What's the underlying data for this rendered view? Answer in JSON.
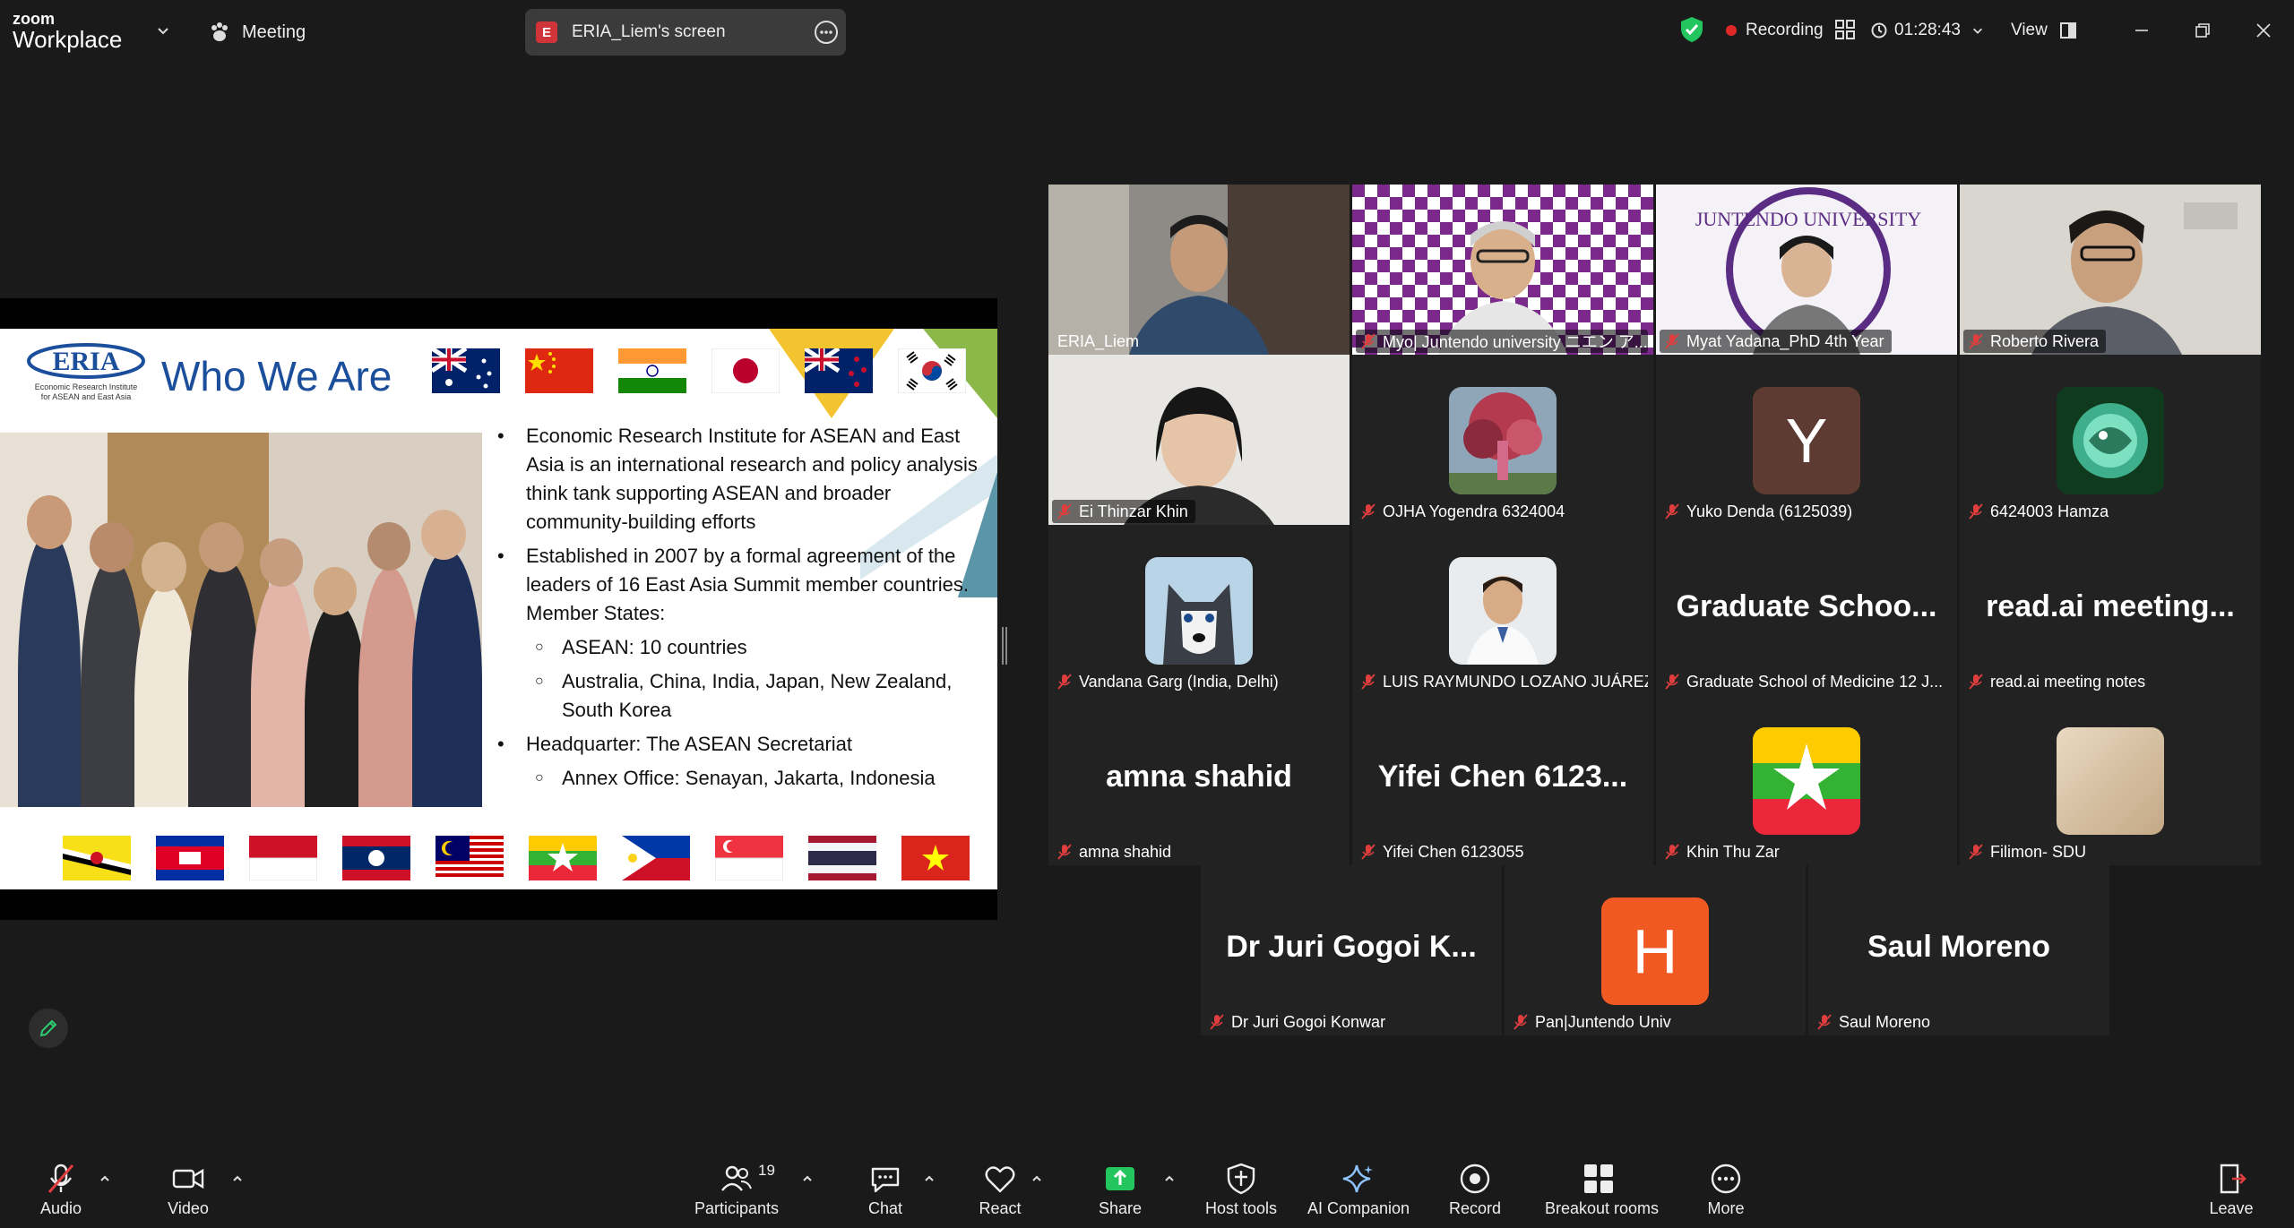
{
  "app": {
    "logo_top": "zoom",
    "logo_bottom": "Workplace",
    "meeting_label": "Meeting",
    "screen_badge": "E",
    "screen_label": "ERIA_Liem's screen",
    "recording_label": "Recording",
    "timer": "01:28:43",
    "view_label": "View"
  },
  "slide": {
    "title": "Who We Are",
    "bullets": [
      {
        "level": 1,
        "text": "Economic Research Institute for ASEAN and East Asia is an international research and policy analysis think tank supporting ASEAN and broader community-building efforts"
      },
      {
        "level": 1,
        "text": "Established in 2007 by a formal agreement of the leaders of 16 East Asia Summit member countries. Member States:"
      },
      {
        "level": 2,
        "text": "ASEAN: 10 countries"
      },
      {
        "level": 2,
        "text": "Australia, China, India, Japan, New Zealand, South Korea"
      },
      {
        "level": 1,
        "text": "Headquarter: The ASEAN Secretariat"
      },
      {
        "level": 2,
        "text": "Annex Office: Senayan, Jakarta, Indonesia"
      }
    ]
  },
  "participants": [
    {
      "name": "ERIA_Liem",
      "big": "",
      "kind": "camera",
      "active": true,
      "muted": false
    },
    {
      "name": "Myo| Juntendo university ニエン ア...",
      "big": "",
      "kind": "camera",
      "active": false,
      "muted": true
    },
    {
      "name": "Myat Yadana_PhD 4th Year",
      "big": "",
      "kind": "camera",
      "active": false,
      "muted": true
    },
    {
      "name": "Roberto Rivera",
      "big": "",
      "kind": "camera",
      "active": false,
      "muted": true
    },
    {
      "name": "Ei Thinzar Khin",
      "big": "",
      "kind": "camera",
      "active": false,
      "muted": true
    },
    {
      "name": "OJHA Yogendra 6324004",
      "big": "",
      "kind": "avatar",
      "active": false,
      "muted": true
    },
    {
      "name": "Yuko Denda (6125039)",
      "big": "Y",
      "kind": "letter",
      "active": false,
      "muted": true
    },
    {
      "name": "6424003 Hamza",
      "big": "",
      "kind": "avatar",
      "active": false,
      "muted": true
    },
    {
      "name": "Vandana Garg (India, Delhi)",
      "big": "",
      "kind": "avatar",
      "active": false,
      "muted": true
    },
    {
      "name": "LUIS RAYMUNDO LOZANO JUÁREZ",
      "big": "",
      "kind": "avatar",
      "active": false,
      "muted": true
    },
    {
      "name": "Graduate School of Medicine 12 J...",
      "big": "Graduate Schoo...",
      "kind": "text",
      "active": false,
      "muted": true
    },
    {
      "name": "read.ai meeting notes",
      "big": "read.ai meeting...",
      "kind": "text",
      "active": false,
      "muted": true
    },
    {
      "name": "amna shahid",
      "big": "amna shahid",
      "kind": "text",
      "active": false,
      "muted": true
    },
    {
      "name": "Yifei Chen 6123055",
      "big": "Yifei Chen 6123...",
      "kind": "text",
      "active": false,
      "muted": true
    },
    {
      "name": "Khin Thu Zar",
      "big": "",
      "kind": "avatar",
      "active": false,
      "muted": true
    },
    {
      "name": "Filimon- SDU",
      "big": "",
      "kind": "avatar",
      "active": false,
      "muted": true
    },
    {
      "name": "Dr Juri Gogoi Konwar",
      "big": "Dr Juri Gogoi K...",
      "kind": "text",
      "active": false,
      "muted": true
    },
    {
      "name": "Pan|Juntendo Univ",
      "big": "H",
      "kind": "letter",
      "active": false,
      "muted": true
    },
    {
      "name": "Saul Moreno",
      "big": "Saul Moreno",
      "kind": "text",
      "active": false,
      "muted": true
    }
  ],
  "toolbar": {
    "audio": "Audio",
    "video": "Video",
    "participants": "Participants",
    "participants_count": "19",
    "chat": "Chat",
    "react": "React",
    "share": "Share",
    "host_tools": "Host tools",
    "ai_companion": "AI Companion",
    "record": "Record",
    "breakout_rooms": "Breakout rooms",
    "more": "More",
    "leave": "Leave"
  },
  "colors": {
    "background": "#1a1a1a",
    "active_speaker": "#2ecc71",
    "recording": "#e02828",
    "share_green": "#22c55e",
    "slide_title": "#1b4f9c",
    "avatar_y": "#5d3b32",
    "avatar_h": "#f05a22"
  }
}
